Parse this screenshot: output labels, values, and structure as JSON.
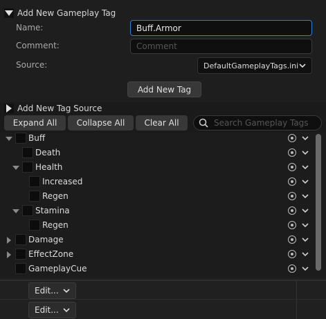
{
  "add_tag_section": {
    "title": "Add New Gameplay Tag",
    "name_label": "Name:",
    "name_value": "Buff.Armor",
    "comment_label": "Comment:",
    "comment_placeholder": "Comment",
    "source_label": "Source:",
    "source_value": "DefaultGameplayTags.ini",
    "add_button": "Add New Tag"
  },
  "add_source_section": {
    "title": "Add New Tag Source"
  },
  "toolbar": {
    "expand_all": "Expand All",
    "collapse_all": "Collapse All",
    "clear_all": "Clear All",
    "search_placeholder": "Search Gameplay Tags"
  },
  "tree": {
    "rows": [
      {
        "label": "Buff",
        "depth": 0,
        "expander": "down"
      },
      {
        "label": "Death",
        "depth": 1,
        "expander": "none"
      },
      {
        "label": "Health",
        "depth": 1,
        "expander": "down"
      },
      {
        "label": "Increased",
        "depth": 2,
        "expander": "none"
      },
      {
        "label": "Regen",
        "depth": 2,
        "expander": "none"
      },
      {
        "label": "Stamina",
        "depth": 1,
        "expander": "down"
      },
      {
        "label": "Regen",
        "depth": 2,
        "expander": "none"
      },
      {
        "label": "Damage",
        "depth": 0,
        "expander": "right"
      },
      {
        "label": "EffectZone",
        "depth": 0,
        "expander": "right"
      },
      {
        "label": "GameplayCue",
        "depth": 0,
        "expander": "none"
      }
    ]
  },
  "bottom": {
    "edit_1": "Edit...",
    "edit_2": "Edit..."
  },
  "colors": {
    "focus_border": "#2f7fd6",
    "background": "#1a1a1a"
  }
}
